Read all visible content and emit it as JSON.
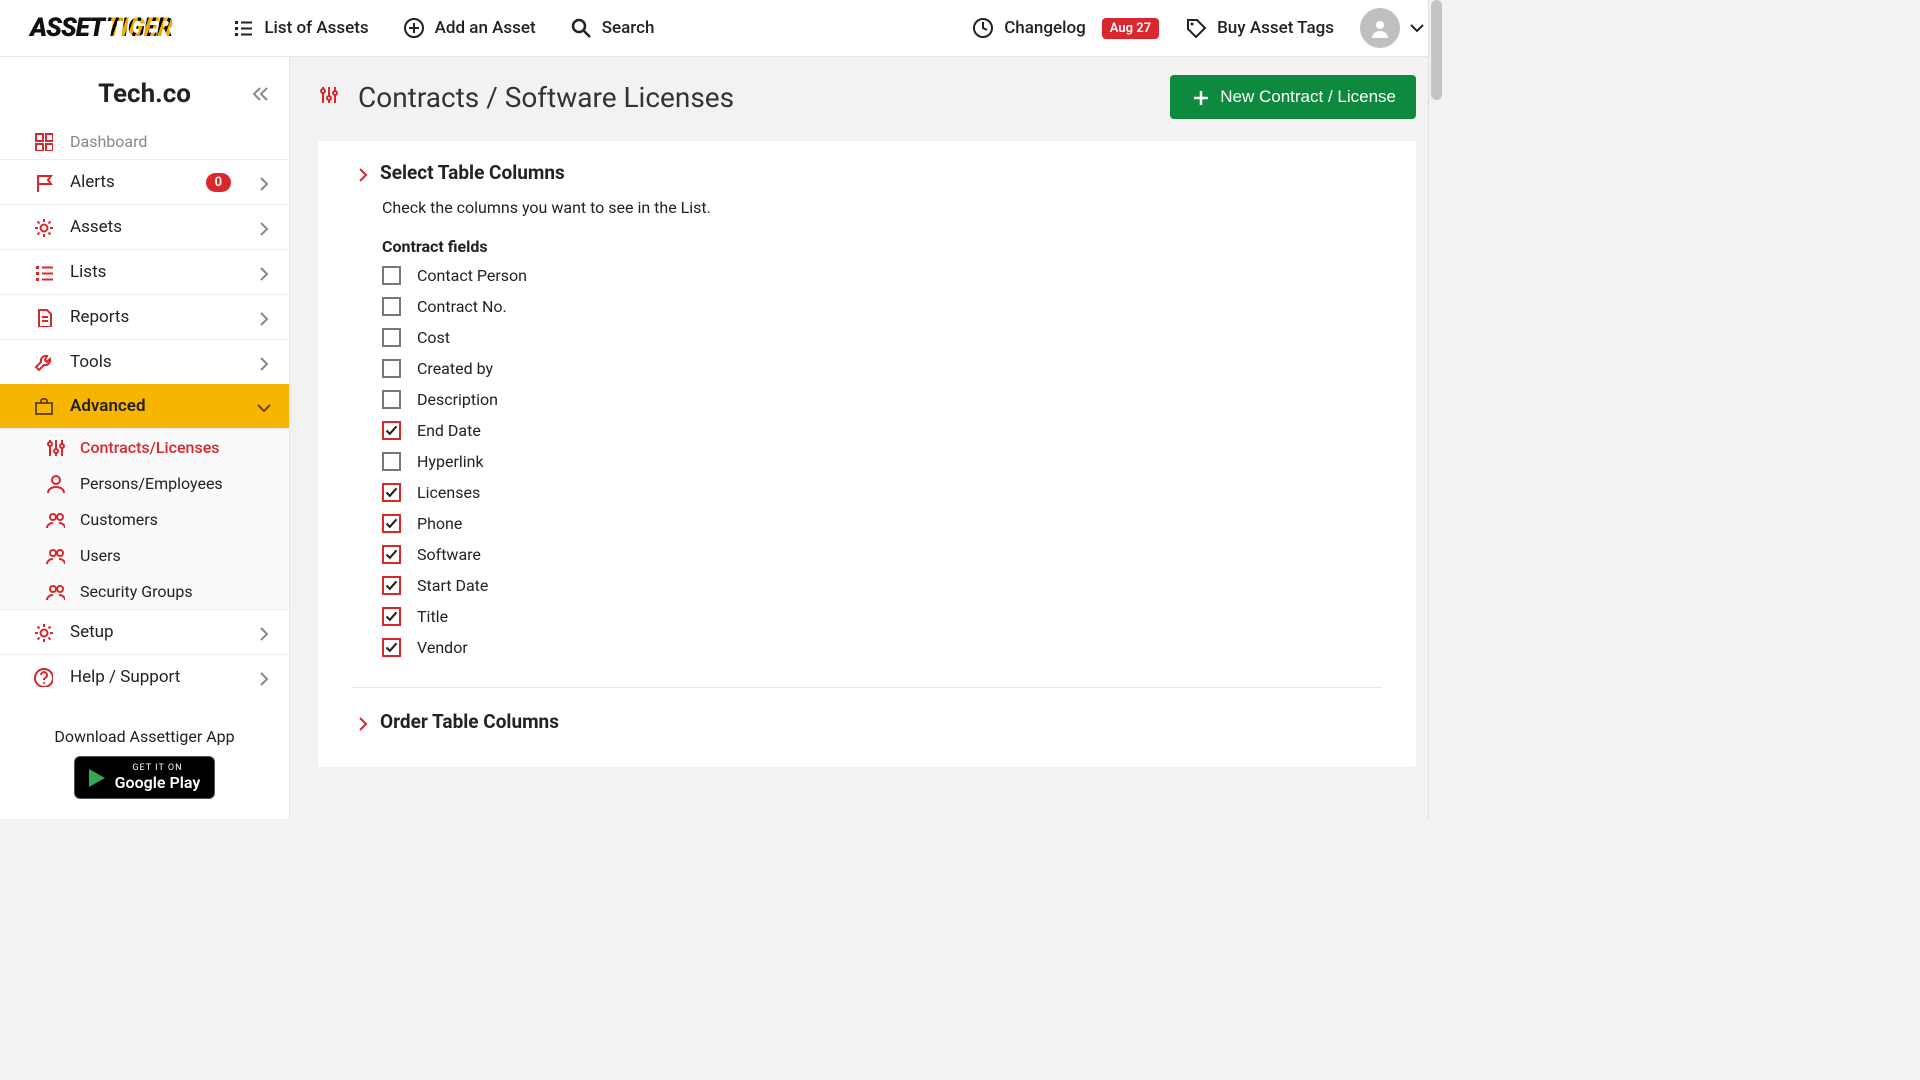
{
  "logo": {
    "left": "ASSET",
    "right": "TIGER"
  },
  "topnav": {
    "list": "List of Assets",
    "add": "Add an Asset",
    "search": "Search"
  },
  "topright": {
    "changelog": "Changelog",
    "changelog_badge": "Aug 27",
    "buy_tags": "Buy Asset Tags"
  },
  "company": "Tech.co",
  "sidebar": {
    "dashboard": "Dashboard",
    "alerts": {
      "label": "Alerts",
      "badge": "0"
    },
    "assets": "Assets",
    "lists": "Lists",
    "reports": "Reports",
    "tools": "Tools",
    "advanced": "Advanced",
    "sub": {
      "contracts": "Contracts/Licenses",
      "persons": "Persons/Employees",
      "customers": "Customers",
      "users": "Users",
      "security": "Security Groups"
    },
    "setup": "Setup",
    "help": "Help / Support"
  },
  "download": {
    "text": "Download Assettiger App",
    "small": "GET IT ON",
    "store": "Google Play"
  },
  "page": {
    "title": "Contracts / Software Licenses",
    "new_btn": "New Contract / License",
    "section1": "Select Table Columns",
    "hint": "Check the columns you want to see in the List.",
    "fieldset": "Contract fields",
    "checks": [
      {
        "label": "Contact Person",
        "checked": false
      },
      {
        "label": "Contract No.",
        "checked": false
      },
      {
        "label": "Cost",
        "checked": false
      },
      {
        "label": "Created by",
        "checked": false
      },
      {
        "label": "Description",
        "checked": false
      },
      {
        "label": "End Date",
        "checked": true
      },
      {
        "label": "Hyperlink",
        "checked": false
      },
      {
        "label": "Licenses",
        "checked": true
      },
      {
        "label": "Phone",
        "checked": true
      },
      {
        "label": "Software",
        "checked": true
      },
      {
        "label": "Start Date",
        "checked": true
      },
      {
        "label": "Title",
        "checked": true
      },
      {
        "label": "Vendor",
        "checked": true
      }
    ],
    "section2": "Order Table Columns"
  }
}
